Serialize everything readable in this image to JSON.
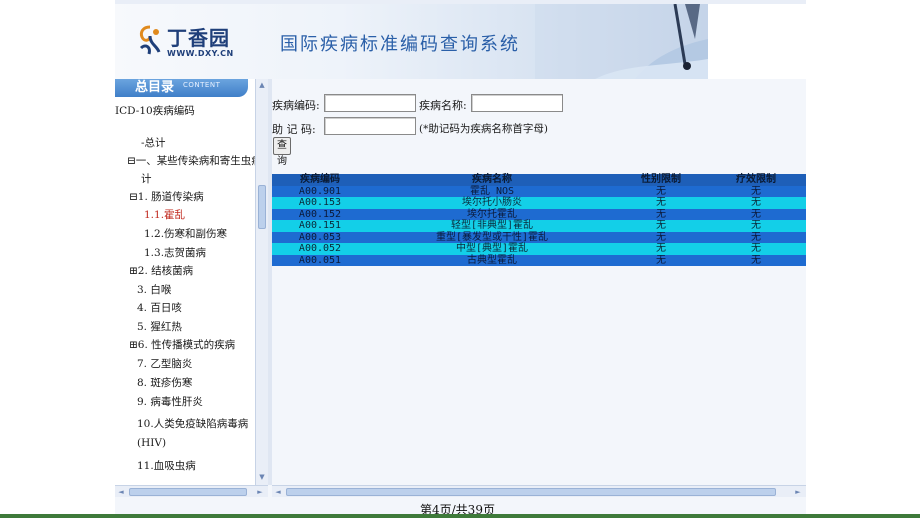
{
  "header": {
    "logo_name": "丁香园",
    "logo_url": "WWW.DXY.CN",
    "system_title": "国际疾病标准编码查询系统"
  },
  "sidebar": {
    "heading": "总目录",
    "heading_sub": "CONTENT",
    "root": "ICD-10疾病编码",
    "items": [
      {
        "label": "-总计"
      },
      {
        "label": "⊟一、某些传染病和寄生虫病小"
      },
      {
        "label": "计"
      },
      {
        "label": "⊟1. 肠道传染病"
      },
      {
        "label": "1.1.霍乱"
      },
      {
        "label": "1.2.伤寒和副伤寒"
      },
      {
        "label": "1.3.志贺菌病"
      },
      {
        "label": "⊞2. 结核菌病"
      },
      {
        "label": "3. 白喉"
      },
      {
        "label": "4. 百日咳"
      },
      {
        "label": "5. 猩红热"
      },
      {
        "label": "⊞6. 性传播模式的疾病"
      },
      {
        "label": "7. 乙型脑炎"
      },
      {
        "label": "8. 斑疹伤寒"
      },
      {
        "label": "9. 病毒性肝炎"
      },
      {
        "label": "10.人类免疫缺陷病毒病"
      },
      {
        "label": "(HIV)"
      },
      {
        "label": "11.血吸虫病"
      }
    ]
  },
  "search": {
    "code_label": "疾病编码:",
    "name_label": "疾病名称:",
    "mnemonic_label": "助 记 码:",
    "mnemonic_hint": "(*助记码为疾病名称首字母)",
    "code_value": "",
    "name_value": "",
    "mnemonic_value": "",
    "query_button": "查询"
  },
  "results": {
    "columns": [
      "疾病编码",
      "疾病名称",
      "性别限制",
      "疗效限制"
    ],
    "rows": [
      {
        "code": "A00.901",
        "name": "霍乱 NOS",
        "sex": "无",
        "effect": "无"
      },
      {
        "code": "A00.153",
        "name": "埃尔托小肠炎",
        "sex": "无",
        "effect": "无"
      },
      {
        "code": "A00.152",
        "name": "埃尔托霍乱",
        "sex": "无",
        "effect": "无"
      },
      {
        "code": "A00.151",
        "name": "轻型[非典型]霍乱",
        "sex": "无",
        "effect": "无"
      },
      {
        "code": "A00.053",
        "name": "重型[暴发型或干性]霍乱",
        "sex": "无",
        "effect": "无"
      },
      {
        "code": "A00.052",
        "name": "中型[典型]霍乱",
        "sex": "无",
        "effect": "无"
      },
      {
        "code": "A00.051",
        "name": "古典型霍乱",
        "sex": "无",
        "effect": "无"
      }
    ]
  },
  "footer": {
    "page_indicator": "第4页/共39页"
  },
  "colors": {
    "header_row": "#1e5fb8",
    "dark_row": "#1e6bd1",
    "light_row": "#13cfe8",
    "selected_tree_item": "#c0281e"
  }
}
